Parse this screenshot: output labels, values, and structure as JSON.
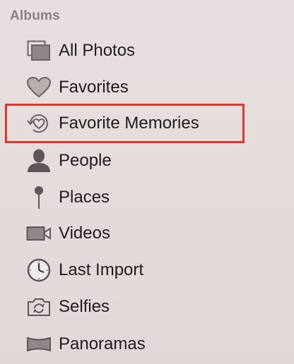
{
  "albums": {
    "header": "Albums",
    "items": [
      {
        "label": "All Photos",
        "icon": "photos-stack-icon"
      },
      {
        "label": "Favorites",
        "icon": "heart-icon"
      },
      {
        "label": "Favorite Memories",
        "icon": "memories-heart-icon"
      },
      {
        "label": "People",
        "icon": "person-icon"
      },
      {
        "label": "Places",
        "icon": "pin-icon"
      },
      {
        "label": "Videos",
        "icon": "video-camera-icon"
      },
      {
        "label": "Last Import",
        "icon": "clock-icon"
      },
      {
        "label": "Selfies",
        "icon": "selfie-camera-icon"
      },
      {
        "label": "Panoramas",
        "icon": "panorama-icon"
      }
    ]
  },
  "colors": {
    "highlight": "#d93a30",
    "icon": "#6b6464",
    "text": "#1f1c1c",
    "header": "#8a8282"
  }
}
